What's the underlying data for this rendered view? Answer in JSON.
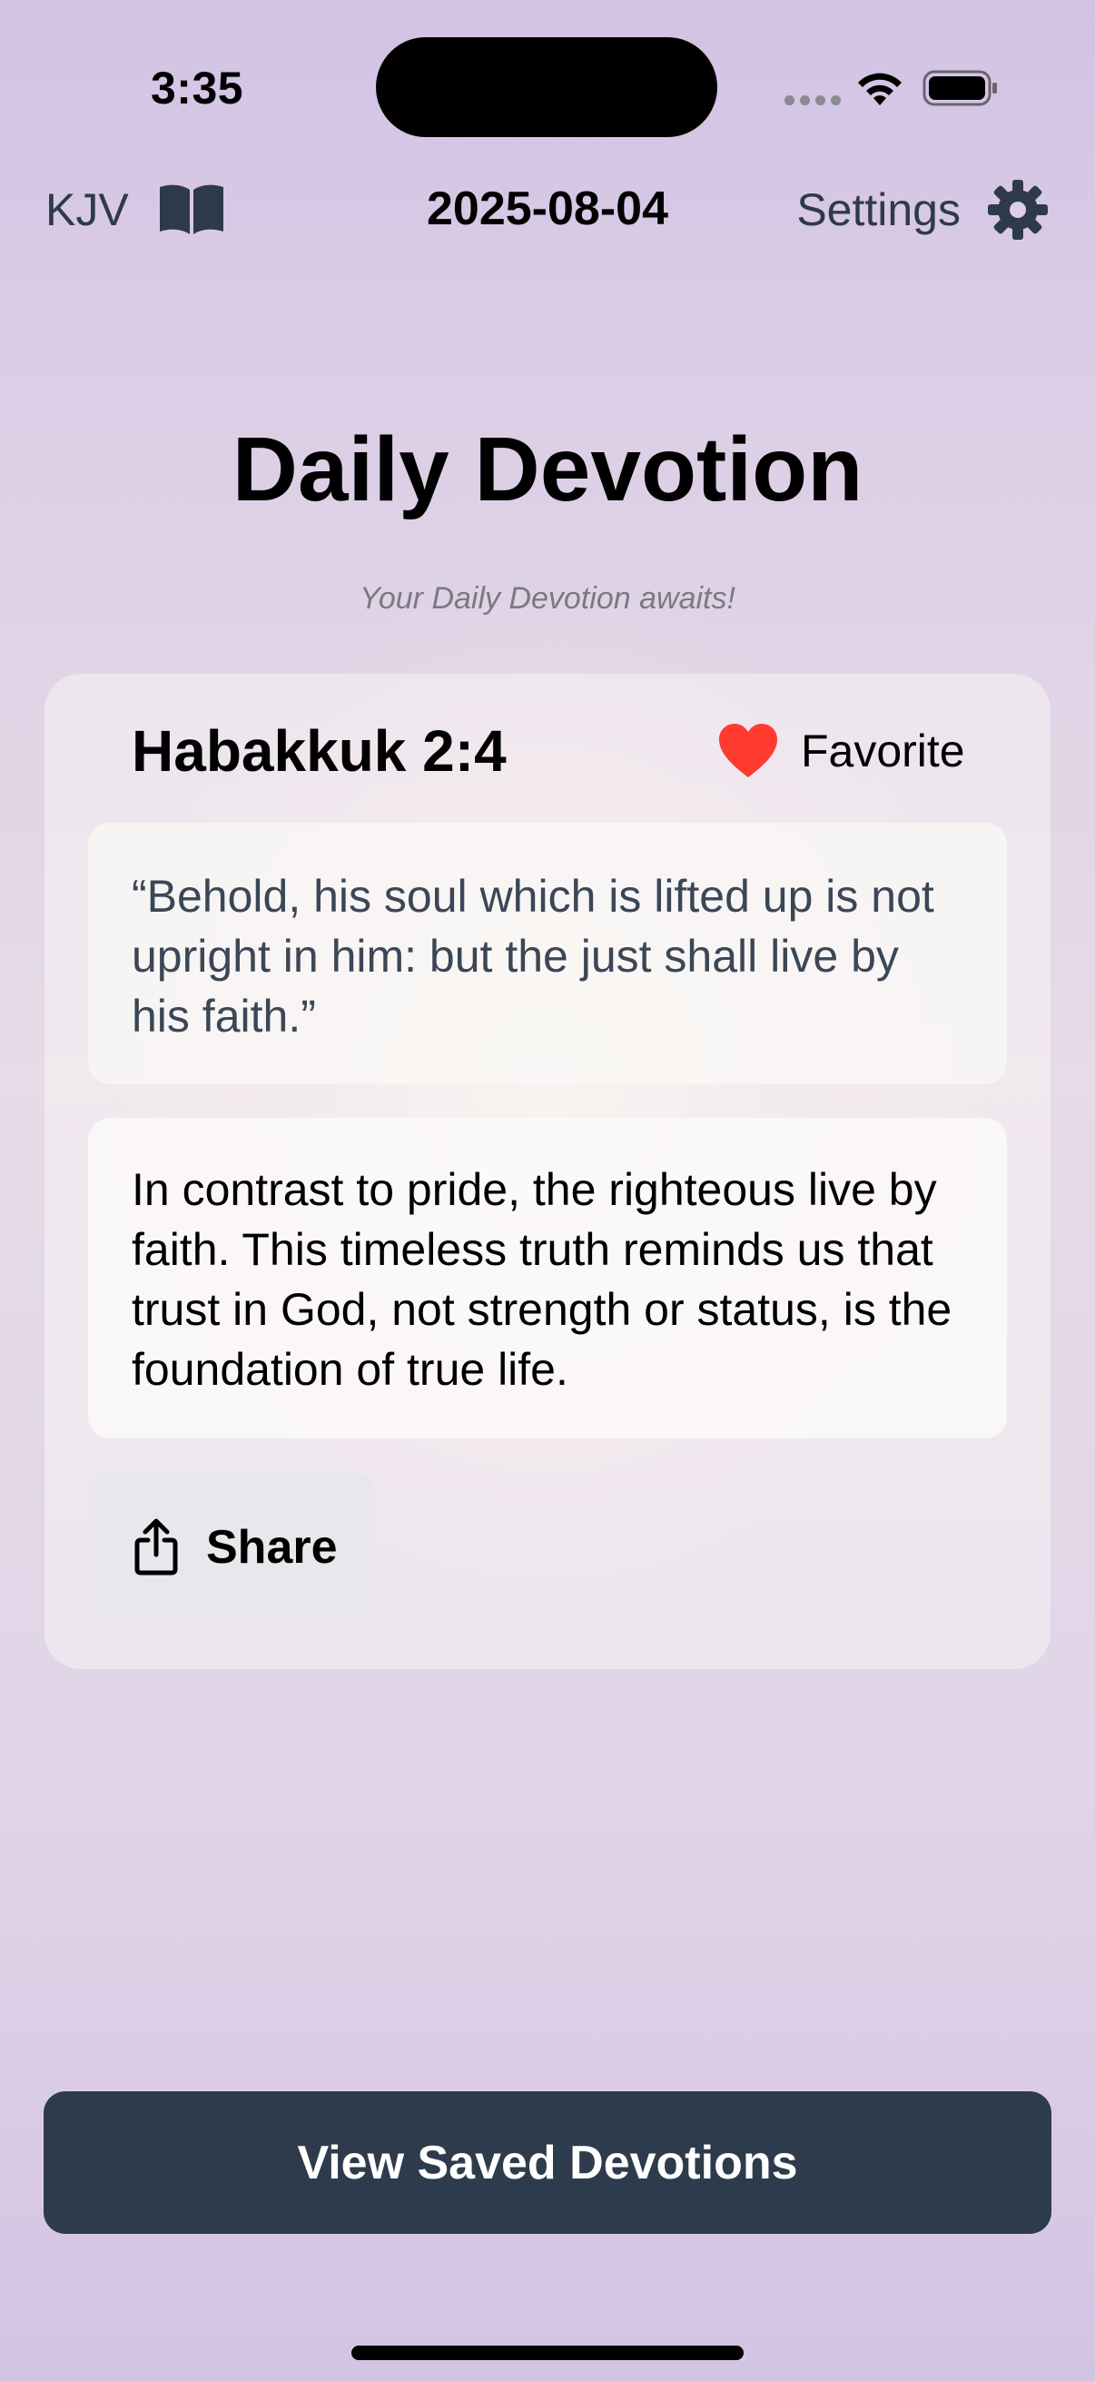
{
  "status_bar": {
    "time": "3:35"
  },
  "nav": {
    "translation": "KJV",
    "translation_icon": "book-icon",
    "date": "2025-08-04",
    "settings_label": "Settings",
    "settings_icon": "gear-icon"
  },
  "header": {
    "title": "Daily Devotion",
    "subtitle": "Your Daily Devotion awaits!"
  },
  "devotion": {
    "reference": "Habakkuk 2:4",
    "favorite_label": "Favorite",
    "favorite_icon": "heart-icon",
    "verse": "“Behold, his soul which is lifted up is not upright in him: but the just shall live by his faith.”",
    "reflection": "In contrast to pride, the righteous live by faith. This timeless truth reminds us that trust in God, not strength or status, is the foundation of true life.",
    "share_label": "Share",
    "share_icon": "share-icon"
  },
  "footer": {
    "saved_button_label": "View Saved Devotions"
  },
  "colors": {
    "accent_dark": "#2e3b4c",
    "heart": "#ff3b30",
    "muted_text": "#7a7a82"
  }
}
